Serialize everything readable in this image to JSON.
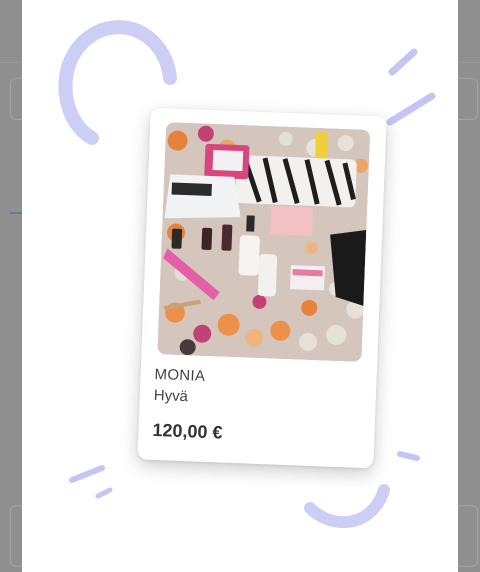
{
  "product": {
    "brand": "MONIA",
    "condition": "Hyvä",
    "price": "120,00 €",
    "image": "nail kit photo"
  },
  "colors": {
    "accent": "#b5b8f2",
    "overlay": "#8f8f8f"
  }
}
